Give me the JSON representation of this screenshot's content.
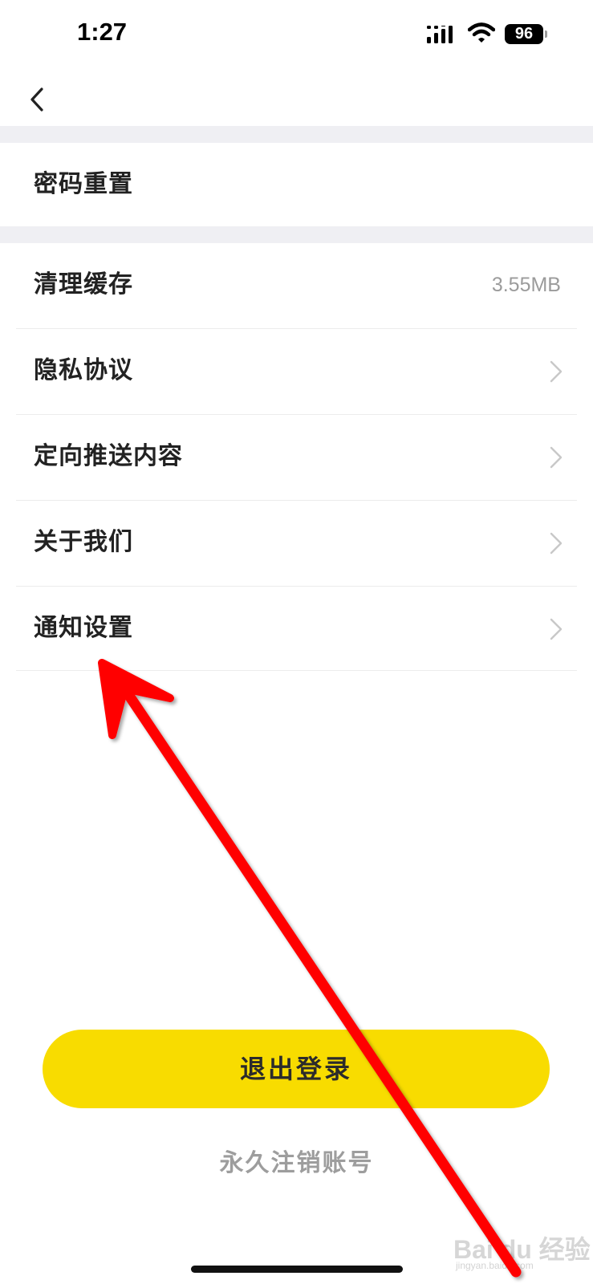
{
  "status_bar": {
    "time": "1:27",
    "battery": "96"
  },
  "settings": {
    "account_items": [
      {
        "label": "密码重置"
      }
    ],
    "general_items": [
      {
        "label": "清理缓存",
        "value": "3.55MB"
      },
      {
        "label": "隐私协议"
      },
      {
        "label": "定向推送内容"
      },
      {
        "label": "关于我们"
      },
      {
        "label": "通知设置"
      }
    ]
  },
  "actions": {
    "logout_label": "退出登录",
    "delete_account_label": "永久注销账号"
  },
  "watermark": {
    "main": "Bai du 经验",
    "sub": "jingyan.baidu.com"
  },
  "colors": {
    "accent": "#f8dc00",
    "section_gap": "#efeff3",
    "annotation_arrow": "#ff0000"
  },
  "icons": [
    "back-arrow",
    "chevron-right",
    "cellular-signal",
    "wifi",
    "battery"
  ]
}
